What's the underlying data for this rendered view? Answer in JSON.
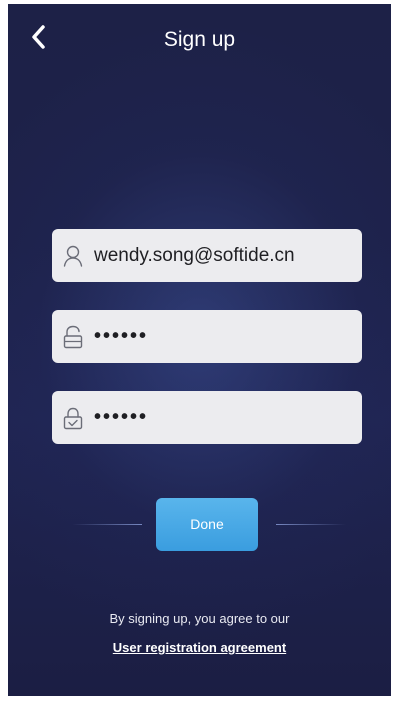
{
  "header": {
    "title": "Sign up",
    "back_icon": "chevron-left-icon"
  },
  "form": {
    "email": {
      "icon": "user-icon",
      "value": "wendy.song@softide.cn"
    },
    "password": {
      "icon": "unlock-icon",
      "value": "••••••"
    },
    "confirm_password": {
      "icon": "lock-check-icon",
      "value": "••••••"
    }
  },
  "actions": {
    "done_label": "Done"
  },
  "agreement": {
    "text": "By signing up, you agree to our",
    "link_label": "User registration agreement"
  },
  "colors": {
    "background": "#1d2147",
    "accent": "#4aa9e8",
    "field_bg": "#ececef"
  }
}
